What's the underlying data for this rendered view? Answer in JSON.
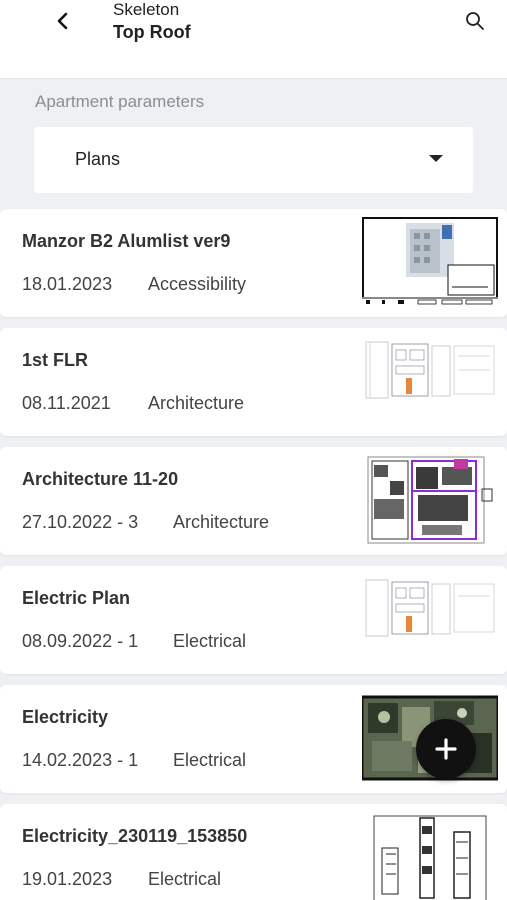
{
  "header": {
    "subtitle": "Skeleton",
    "title": "Top Roof"
  },
  "filter": {
    "label": "Apartment parameters",
    "selected": "Plans"
  },
  "plans": [
    {
      "name": "Manzor B2 Alumlist ver9",
      "date": "18.01.2023",
      "category": "Accessibility"
    },
    {
      "name": "1st FLR",
      "date": "08.11.2021",
      "category": "Architecture"
    },
    {
      "name": "Architecture 11-20",
      "date": "27.10.2022 - 3",
      "category": "Architecture"
    },
    {
      "name": "Electric Plan",
      "date": "08.09.2022 - 1",
      "category": "Electrical"
    },
    {
      "name": "Electricity",
      "date": "14.02.2023 - 1",
      "category": "Electrical"
    },
    {
      "name": "Electricity_230119_153850",
      "date": "19.01.2023",
      "category": "Electrical"
    }
  ],
  "icons": {
    "back": "chevron-left-icon",
    "search": "search-icon",
    "dropdown": "caret-down-icon",
    "add": "plus-icon"
  },
  "colors": {
    "background": "#eef0f3",
    "card": "#ffffff",
    "fab": "#111111",
    "label_gray": "#8a8d92"
  }
}
